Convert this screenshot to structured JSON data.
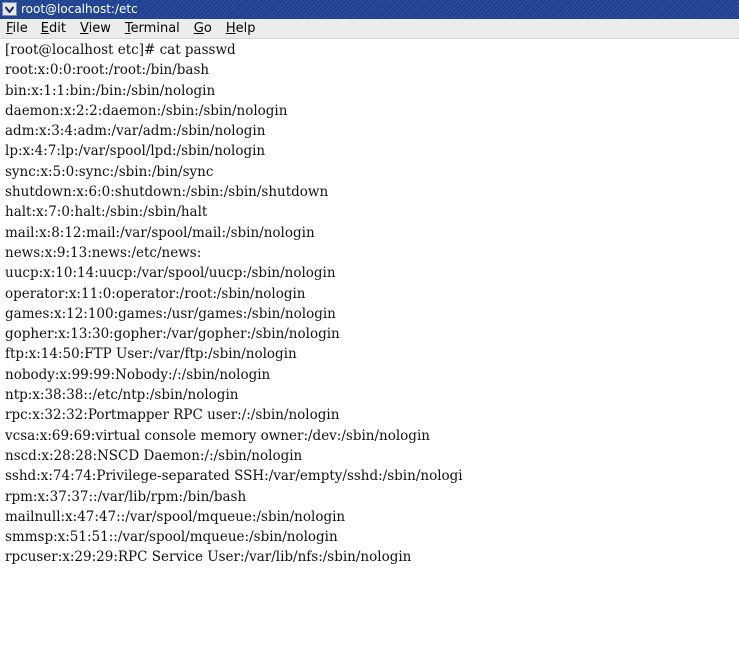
{
  "window": {
    "title": "root@localhost:/etc",
    "menu_icon": "chevron-down-icon"
  },
  "menubar": {
    "items": [
      {
        "label": "File",
        "mnemonic": "F",
        "rest": "ile"
      },
      {
        "label": "Edit",
        "mnemonic": "E",
        "rest": "dit"
      },
      {
        "label": "View",
        "mnemonic": "V",
        "rest": "iew"
      },
      {
        "label": "Terminal",
        "mnemonic": "T",
        "rest": "erminal"
      },
      {
        "label": "Go",
        "mnemonic": "G",
        "rest": "o"
      },
      {
        "label": "Help",
        "mnemonic": "H",
        "rest": "elp"
      }
    ]
  },
  "terminal": {
    "lines": [
      "[root@localhost etc]# cat passwd",
      "root:x:0:0:root:/root:/bin/bash",
      "bin:x:1:1:bin:/bin:/sbin/nologin",
      "daemon:x:2:2:daemon:/sbin:/sbin/nologin",
      "adm:x:3:4:adm:/var/adm:/sbin/nologin",
      "lp:x:4:7:lp:/var/spool/lpd:/sbin/nologin",
      "sync:x:5:0:sync:/sbin:/bin/sync",
      "shutdown:x:6:0:shutdown:/sbin:/sbin/shutdown",
      "halt:x:7:0:halt:/sbin:/sbin/halt",
      "mail:x:8:12:mail:/var/spool/mail:/sbin/nologin",
      "news:x:9:13:news:/etc/news:",
      "uucp:x:10:14:uucp:/var/spool/uucp:/sbin/nologin",
      "operator:x:11:0:operator:/root:/sbin/nologin",
      "games:x:12:100:games:/usr/games:/sbin/nologin",
      "gopher:x:13:30:gopher:/var/gopher:/sbin/nologin",
      "ftp:x:14:50:FTP User:/var/ftp:/sbin/nologin",
      "nobody:x:99:99:Nobody:/:/sbin/nologin",
      "ntp:x:38:38::/etc/ntp:/sbin/nologin",
      "rpc:x:32:32:Portmapper RPC user:/:/sbin/nologin",
      "vcsa:x:69:69:virtual console memory owner:/dev:/sbin/nologin",
      "nscd:x:28:28:NSCD Daemon:/:/sbin/nologin",
      "sshd:x:74:74:Privilege-separated SSH:/var/empty/sshd:/sbin/nologi",
      "rpm:x:37:37::/var/lib/rpm:/bin/bash",
      "mailnull:x:47:47::/var/spool/mqueue:/sbin/nologin",
      "smmsp:x:51:51::/var/spool/mqueue:/sbin/nologin",
      "rpcuser:x:29:29:RPC Service User:/var/lib/nfs:/sbin/nologin"
    ]
  },
  "colors": {
    "titlebar": "#1c3f8f",
    "menubar": "#ececec",
    "terminal_bg": "#ffffff",
    "terminal_fg": "#111111"
  }
}
